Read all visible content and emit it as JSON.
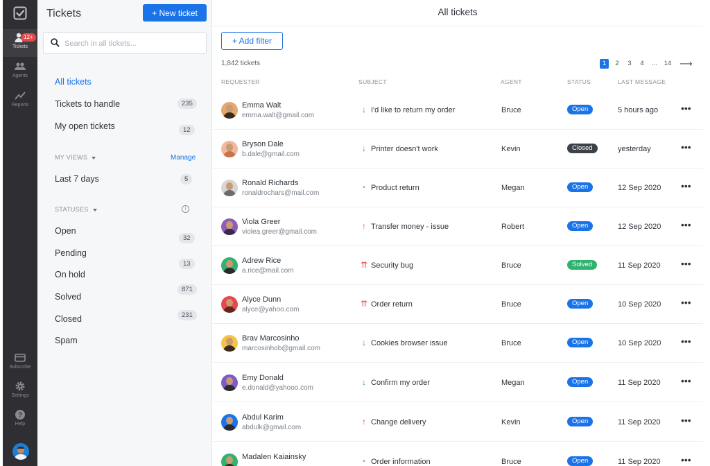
{
  "rail": {
    "items": [
      {
        "label": "Tickets",
        "badge": "12+"
      },
      {
        "label": "Agents"
      },
      {
        "label": "Reports"
      },
      {
        "label": "Subscribe"
      },
      {
        "label": "Settings"
      },
      {
        "label": "Help"
      }
    ]
  },
  "sidebar": {
    "title": "Tickets",
    "new_ticket_label": "+ New ticket",
    "search_placeholder": "Search in all tickets...",
    "nav": [
      {
        "label": "All tickets",
        "count": ""
      },
      {
        "label": "Tickets to handle",
        "count": "235"
      },
      {
        "label": "My open tickets",
        "count": "12"
      }
    ],
    "my_views": {
      "header": "MY VIEWS",
      "manage": "Manage",
      "items": [
        {
          "label": "Last 7 days",
          "count": "5"
        }
      ]
    },
    "statuses": {
      "header": "STATUSES",
      "items": [
        {
          "label": "Open",
          "count": "32"
        },
        {
          "label": "Pending",
          "count": "13"
        },
        {
          "label": "On hold",
          "count": "871"
        },
        {
          "label": "Solved",
          "count": "231"
        },
        {
          "label": "Closed",
          "count": ""
        },
        {
          "label": "Spam",
          "count": ""
        }
      ]
    }
  },
  "main": {
    "title": "All tickets",
    "add_filter_label": "+ Add filter",
    "total": "1,842 tickets",
    "pager": {
      "pages": [
        "1",
        "2",
        "3",
        "4",
        "...",
        "14"
      ],
      "current": "1",
      "next": "⟶"
    },
    "columns": {
      "requester": "REQUESTER",
      "subject": "SUBJECT",
      "agent": "AGENT",
      "status": "STATUS",
      "last": "LAST MESSAGE"
    },
    "more_glyph": "•••",
    "tickets": [
      {
        "name": "Emma Walt",
        "email": "emma.walt@gmail.com",
        "priority": "low",
        "subject": "I'd like to return my order",
        "agent": "Bruce",
        "status": "Open",
        "last": "5 hours ago"
      },
      {
        "name": "Bryson Dale",
        "email": "b.dale@gmail.com",
        "priority": "low",
        "subject": "Printer doesn't work",
        "agent": "Kevin",
        "status": "Closed",
        "last": "yesterday"
      },
      {
        "name": "Ronald Richards",
        "email": "ronaldrochars@mail.com",
        "priority": "normal",
        "subject": "Product return",
        "agent": "Megan",
        "status": "Open",
        "last": "12 Sep 2020"
      },
      {
        "name": "Viola Greer",
        "email": "violea.greer@gmail.com",
        "priority": "high",
        "subject": "Transfer money - issue",
        "agent": "Robert",
        "status": "Open",
        "last": "12 Sep 2020"
      },
      {
        "name": "Adrew Rice",
        "email": "a.rice@mail.com",
        "priority": "urgent",
        "subject": "Security bug",
        "agent": "Bruce",
        "status": "Solved",
        "last": "11 Sep 2020"
      },
      {
        "name": "Alyce Dunn",
        "email": "alyce@yahoo.com",
        "priority": "urgent",
        "subject": "Order return",
        "agent": "Bruce",
        "status": "Open",
        "last": "10 Sep 2020"
      },
      {
        "name": "Brav Marcosinho",
        "email": "marcosinhob@gmail.com",
        "priority": "low",
        "subject": "Cookies browser issue",
        "agent": "Bruce",
        "status": "Open",
        "last": "10 Sep 2020"
      },
      {
        "name": "Emy Donald",
        "email": "e.donald@yahooo.com",
        "priority": "low",
        "subject": "Confirm my order",
        "agent": "Megan",
        "status": "Open",
        "last": "11 Sep 2020"
      },
      {
        "name": "Abdul Karim",
        "email": "abdulk@gmail.com",
        "priority": "high",
        "subject": "Change delivery",
        "agent": "Kevin",
        "status": "Open",
        "last": "11 Sep 2020"
      },
      {
        "name": "Madalen Kaiainsky",
        "email": "",
        "priority": "normal",
        "subject": "Order information",
        "agent": "Bruce",
        "status": "Open",
        "last": "11 Sep 2020"
      }
    ]
  },
  "colors": {
    "accent": "#1a73e8",
    "open": "#1a73e8",
    "closed": "#3d4148",
    "solved": "#2fb36f",
    "priority_low": "#2a9d8f",
    "priority_high": "#e5484d",
    "priority_normal": "#8b929a"
  },
  "priority_glyphs": {
    "low": "↓",
    "normal": "•",
    "high": "↑",
    "urgent": "⇈"
  }
}
